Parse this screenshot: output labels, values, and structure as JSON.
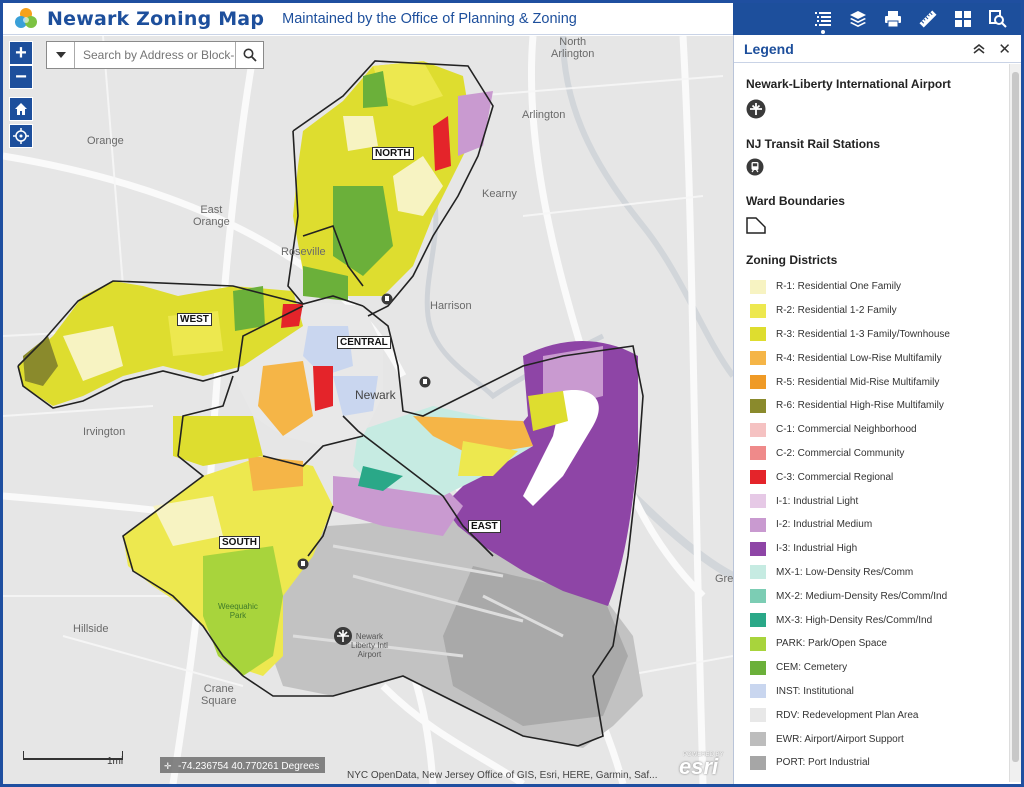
{
  "header": {
    "title": "Newark Zoning Map",
    "subtitle": "Maintained by the Office of Planning & Zoning"
  },
  "toolbar": {
    "tools": [
      {
        "icon": "legend-list-icon",
        "active": true
      },
      {
        "icon": "layers-icon",
        "active": false
      },
      {
        "icon": "print-icon",
        "active": false
      },
      {
        "icon": "measure-ruler-icon",
        "active": false
      },
      {
        "icon": "basemap-gallery-icon",
        "active": false
      },
      {
        "icon": "query-search-icon",
        "active": false
      }
    ]
  },
  "map": {
    "zoom_in": "+",
    "zoom_out": "−",
    "search_placeholder": "Search by Address or Block-",
    "places": {
      "north_arlington": "North\nArlington",
      "arlington": "Arlington",
      "orange": "Orange",
      "kearny": "Kearny",
      "east_orange": "East\nOrange",
      "roseville": "Roseville",
      "harrison": "Harrison",
      "newark": "Newark",
      "irvington": "Irvington",
      "hillside": "Hillside",
      "crane_square": "Crane\nSquare",
      "weequahic_park": "Weequahic\nPark",
      "gre": "Gre",
      "airport": "Newark\nLiberty Intl\nAirport"
    },
    "wards": {
      "north": "NORTH",
      "west": "WEST",
      "central": "CENTRAL",
      "south": "SOUTH",
      "east": "EAST"
    },
    "scale_label": "1mi",
    "coordinates": "-74.236754 40.770261 Degrees",
    "attribution": "NYC OpenData, New Jersey Office of GIS, Esri, HERE, Garmin, Saf...",
    "powered_by": "POWERED BY",
    "esri": "esri"
  },
  "legend": {
    "title": "Legend",
    "layers": {
      "airport": "Newark-Liberty International Airport",
      "rail": "NJ Transit Rail Stations",
      "wards": "Ward Boundaries",
      "zoning": "Zoning Districts"
    },
    "zoning": [
      {
        "label": "R-1: Residential One Family",
        "color": "#f7f3c2"
      },
      {
        "label": "R-2: Residential 1-2 Family",
        "color": "#ede84f"
      },
      {
        "label": "R-3: Residential 1-3 Family/Townhouse",
        "color": "#dedd2f"
      },
      {
        "label": "R-4: Residential Low-Rise Multifamily",
        "color": "#f5b547"
      },
      {
        "label": "R-5: Residential Mid-Rise Multifamily",
        "color": "#ef9a26"
      },
      {
        "label": "R-6: Residential High-Rise Multifamily",
        "color": "#8a8a2c"
      },
      {
        "label": "C-1: Commercial Neighborhood",
        "color": "#f5c2c2"
      },
      {
        "label": "C-2: Commercial Community",
        "color": "#ef8a8a"
      },
      {
        "label": "C-3: Commercial Regional",
        "color": "#e4242a"
      },
      {
        "label": "I-1: Industrial Light",
        "color": "#e6c9e6"
      },
      {
        "label": "I-2: Industrial Medium",
        "color": "#c99ad0"
      },
      {
        "label": "I-3: Industrial High",
        "color": "#8e45a6"
      },
      {
        "label": "MX-1: Low-Density Res/Comm",
        "color": "#c6ebe2"
      },
      {
        "label": "MX-2: Medium-Density Res/Comm/Ind",
        "color": "#7ccdb4"
      },
      {
        "label": "MX-3: High-Density Res/Comm/Ind",
        "color": "#2aa888"
      },
      {
        "label": "PARK: Park/Open Space",
        "color": "#a8d43c"
      },
      {
        "label": "CEM: Cemetery",
        "color": "#6bb03a"
      },
      {
        "label": "INST: Institutional",
        "color": "#c9d6ef"
      },
      {
        "label": "RDV: Redevelopment Plan Area",
        "color": "#e8e8e8"
      },
      {
        "label": "EWR: Airport/Airport Support",
        "color": "#bdbdbd"
      },
      {
        "label": "PORT: Port Industrial",
        "color": "#a6a6a6"
      }
    ]
  }
}
